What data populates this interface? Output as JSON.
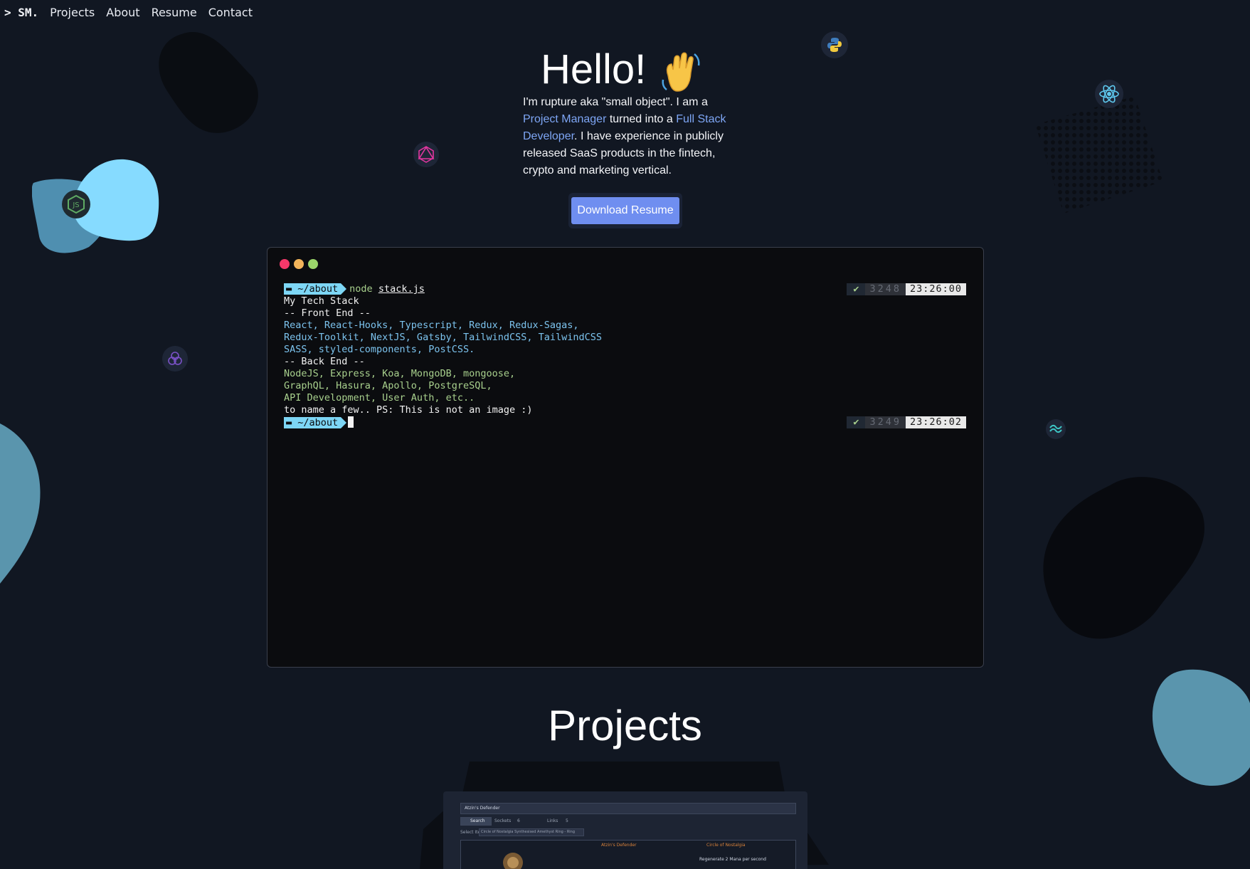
{
  "nav": {
    "logo": "> SM.",
    "links": [
      "Projects",
      "About",
      "Resume",
      "Contact"
    ]
  },
  "hero": {
    "title": "Hello!",
    "intro_parts": {
      "p1": "I'm rupture aka \"small object\". I am a ",
      "h1": "Project Manager",
      "p2": " turned into a ",
      "h2": "Full Stack Developer",
      "p3": ". I have experience in publicly released SaaS products in the fintech, crypto and marketing vertical."
    },
    "button": "Download Resume"
  },
  "terminal": {
    "prompt_dir": "~/about",
    "command": "node",
    "command_arg": "stack.js",
    "status1": {
      "check": "✔",
      "count": "3248",
      "time": "23:26:00"
    },
    "status2": {
      "check": "✔",
      "count": "3249",
      "time": "23:26:02"
    },
    "lines": {
      "heading": "My Tech Stack",
      "front_header": "-- Front End --",
      "front_1": "React, React-Hooks, Typescript, Redux, Redux-Sagas,",
      "front_2": "Redux-Toolkit, NextJS, Gatsby, TailwindCSS, TailwindCSS",
      "front_3": "SASS, styled-components, PostCSS.",
      "back_header": "-- Back End --",
      "back_1": "NodeJS, Express, Koa, MongoDB, mongoose,",
      "back_2": "GraphQL, Hasura, Apollo, PostgreSQL,",
      "back_3": "API Development, User Auth, etc..",
      "footer": "to name a few.. PS: This is not an image :)"
    }
  },
  "projects": {
    "title": "Projects",
    "preview": {
      "heading": "Atzin's Defender",
      "search": "Search",
      "sockets_label": "Sockets",
      "sockets_value": "6",
      "links_label": "Links",
      "links_value": "5",
      "select_label": "Select Item",
      "select_value": "Circle of Nostalgia Synthesised Amethyst Ring - Ring",
      "col1_title": "Atzin's Defender",
      "col2_title": "Circle of Nostalgia",
      "col2_line": "Regenerate 2 Mana per second"
    }
  },
  "colors": {
    "accent": "#6f8ef0",
    "link": "#7ea6f5",
    "prompt": "#7dd6f5",
    "background": "#111722"
  }
}
